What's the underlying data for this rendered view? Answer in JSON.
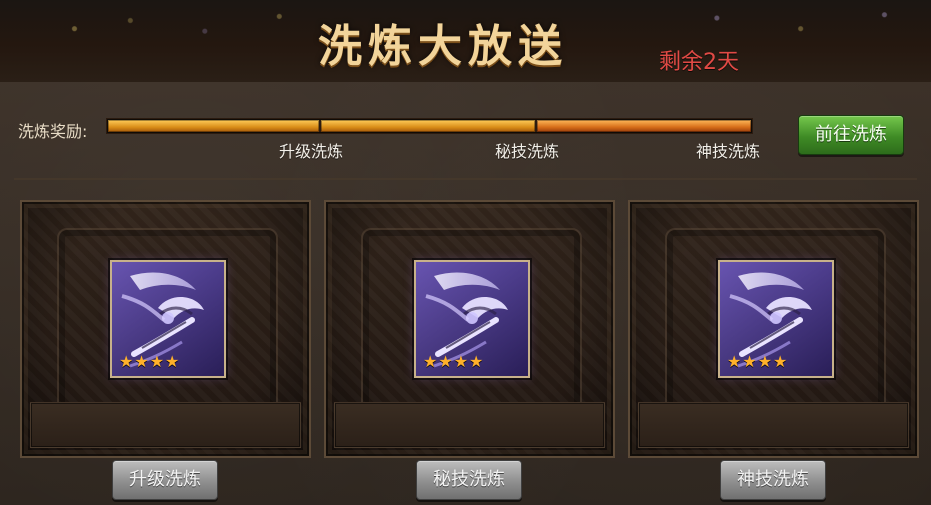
{
  "header": {
    "title": "洗炼大放送",
    "remaining": "剩余2天"
  },
  "reward": {
    "label": "洗炼奖励:",
    "milestones": [
      "升级洗炼",
      "秘技洗炼",
      "神技洗炼"
    ],
    "goto_button": "前往洗炼"
  },
  "cards": [
    {
      "button_label": "升级洗炼",
      "stars": "★★★★"
    },
    {
      "button_label": "秘技洗炼",
      "stars": "★★★★"
    },
    {
      "button_label": "神技洗炼",
      "stars": "★★★★"
    }
  ],
  "colors": {
    "title": "#f2d49a",
    "remaining": "#e14a45",
    "progress_gold": "#d98d18",
    "progress_orange": "#d66d19",
    "green_button": "#3f8b25",
    "grey_button": "#8f8f8f",
    "star": "#ffb12a"
  },
  "icons": {
    "item_icon": "axe-weapon-icon",
    "star_icon": "star-icon"
  }
}
